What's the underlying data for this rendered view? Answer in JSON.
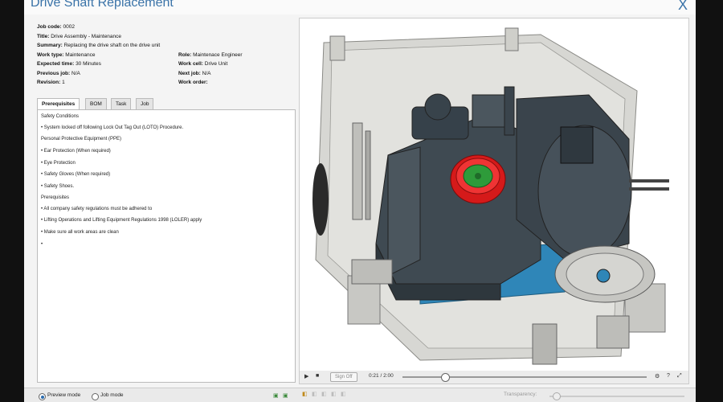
{
  "window": {
    "title": "Drive Shaft Replacement",
    "close_glyph": "X"
  },
  "job": {
    "job_code": {
      "label": "Job code:",
      "value": "0002"
    },
    "title": {
      "label": "Title:",
      "value": "Drive Assembly - Maintenance"
    },
    "summary": {
      "label": "Summary:",
      "value": "Replacing the drive shaft on the drive unit"
    },
    "work_type": {
      "label": "Work type:",
      "value": "Maintenance"
    },
    "role": {
      "label": "Role:",
      "value": "Maintenace Engineer"
    },
    "expected_time": {
      "label": "Expected time:",
      "value": "30 Minutes"
    },
    "work_cell": {
      "label": "Work cell:",
      "value": "Drive Unit"
    },
    "previous_job": {
      "label": "Previous job:",
      "value": "N/A"
    },
    "next_job": {
      "label": "Next job:",
      "value": "N/A"
    },
    "revision": {
      "label": "Revision:",
      "value": "1"
    },
    "work_order": {
      "label": "Work order:",
      "value": ""
    }
  },
  "tabs": [
    {
      "label": "Prerequisites",
      "active": true
    },
    {
      "label": "BOM",
      "active": false
    },
    {
      "label": "Task",
      "active": false
    },
    {
      "label": "Job",
      "active": false
    }
  ],
  "prerequisites": {
    "lines": [
      "Safety Conditions",
      "• System locked off following Lock Out Tag Out (LOTO) Procedure.",
      "Personal Protective Equipment (PPE)",
      "• Ear Protection (When required)",
      "• Eye Protection",
      "• Safety Gloves (When required)",
      "• Safety Shoes.",
      "Prerequisites",
      "• All company safety regulations must be adhered to",
      "• Lifting Operations and Lifting Equipment Regulations 1998 (LOLER) apply",
      "• Make sure all work areas are clean",
      "•"
    ]
  },
  "mode": {
    "preview_label": "Preview mode",
    "job_label": "Job mode",
    "selected": "preview"
  },
  "player": {
    "play_glyph": "▶",
    "stop_glyph": "■",
    "sign_off": "Sign Off",
    "time": "0:21 / 2:00",
    "progress": 0.175,
    "settings_glyph": "⚙",
    "help_glyph": "?",
    "fullscreen_glyph": "⤢"
  },
  "toolbar": {
    "transparency_label": "Transparency:",
    "transparency_value": 0.05
  },
  "colors": {
    "accent": "#3a73a8",
    "highlight_red": "#e01e1e",
    "highlight_green": "#2e9b3a",
    "plate_blue": "#2f86b8"
  }
}
